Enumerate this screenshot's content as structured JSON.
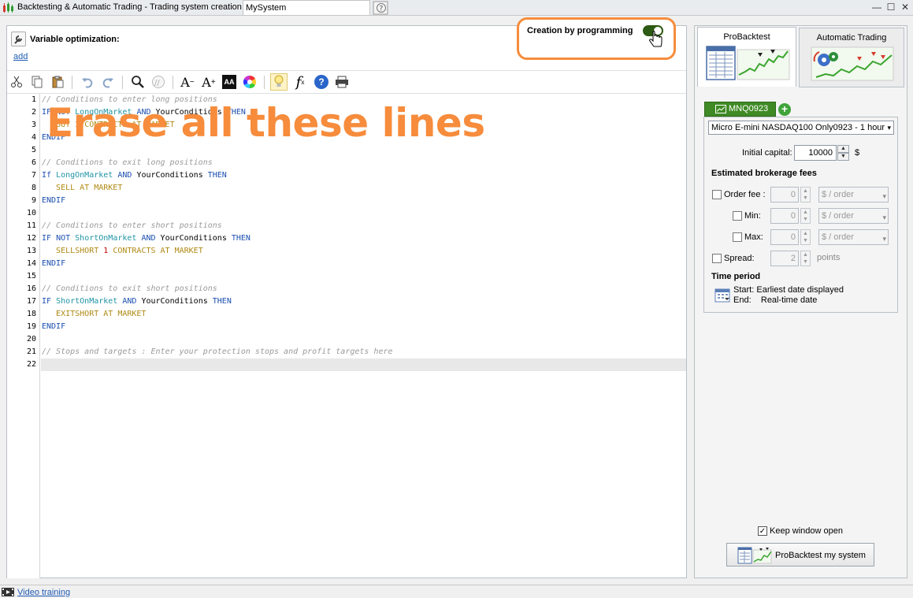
{
  "window": {
    "title": "Backtesting & Automatic Trading - Trading system creation",
    "system_name": "MySystem",
    "controls": {
      "minimize": "—",
      "maximize": "☐",
      "close": "✕"
    }
  },
  "header": {
    "variable_optimization": "Variable optimization:",
    "add_link": "add",
    "creation_by_programming": "Creation by programming",
    "toggle_state": "on"
  },
  "toolbar": {
    "icons": [
      "cut-icon",
      "copy-icon",
      "paste-icon",
      "undo-icon",
      "redo-icon",
      "search-icon",
      "comment-icon",
      "decrease-font-icon",
      "increase-font-icon",
      "text-style-icon",
      "color-wheel-icon",
      "lightbulb-icon",
      "function-icon",
      "help-icon",
      "print-icon"
    ],
    "decrease_font": "A",
    "increase_font": "A",
    "text_style": "AA",
    "function": "f",
    "help": "?"
  },
  "editor": {
    "lines": [
      {
        "n": "1",
        "tokens": [
          {
            "t": "// Conditions to enter long positions",
            "c": "cmt"
          }
        ]
      },
      {
        "n": "2",
        "tokens": [
          {
            "t": "IF ",
            "c": "kw"
          },
          {
            "t": "NOT ",
            "c": "kw"
          },
          {
            "t": "LongOnMarket ",
            "c": "id"
          },
          {
            "t": "AND ",
            "c": "kw"
          },
          {
            "t": "YourConditions ",
            "c": "txt"
          },
          {
            "t": "THEN",
            "c": "kw"
          }
        ]
      },
      {
        "n": "3",
        "tokens": [
          {
            "t": "   BUY ",
            "c": "act"
          },
          {
            "t": "1 ",
            "c": "num"
          },
          {
            "t": "CONTRACTS AT MARKET",
            "c": "act"
          }
        ]
      },
      {
        "n": "4",
        "tokens": [
          {
            "t": "ENDIF",
            "c": "kw"
          }
        ]
      },
      {
        "n": "5",
        "tokens": []
      },
      {
        "n": "6",
        "tokens": [
          {
            "t": "// Conditions to exit long positions",
            "c": "cmt"
          }
        ]
      },
      {
        "n": "7",
        "tokens": [
          {
            "t": "If ",
            "c": "kw"
          },
          {
            "t": "LongOnMarket ",
            "c": "id"
          },
          {
            "t": "AND ",
            "c": "kw"
          },
          {
            "t": "YourConditions ",
            "c": "txt"
          },
          {
            "t": "THEN",
            "c": "kw"
          }
        ]
      },
      {
        "n": "8",
        "tokens": [
          {
            "t": "   SELL AT MARKET",
            "c": "act"
          }
        ]
      },
      {
        "n": "9",
        "tokens": [
          {
            "t": "ENDIF",
            "c": "kw"
          }
        ]
      },
      {
        "n": "10",
        "tokens": []
      },
      {
        "n": "11",
        "tokens": [
          {
            "t": "// Conditions to enter short positions",
            "c": "cmt"
          }
        ]
      },
      {
        "n": "12",
        "tokens": [
          {
            "t": "IF ",
            "c": "kw"
          },
          {
            "t": "NOT ",
            "c": "kw"
          },
          {
            "t": "ShortOnMarket ",
            "c": "id"
          },
          {
            "t": "AND ",
            "c": "kw"
          },
          {
            "t": "YourConditions ",
            "c": "txt"
          },
          {
            "t": "THEN",
            "c": "kw"
          }
        ]
      },
      {
        "n": "13",
        "tokens": [
          {
            "t": "   SELLSHORT ",
            "c": "act"
          },
          {
            "t": "1 ",
            "c": "num"
          },
          {
            "t": "CONTRACTS AT MARKET",
            "c": "act"
          }
        ]
      },
      {
        "n": "14",
        "tokens": [
          {
            "t": "ENDIF",
            "c": "kw"
          }
        ]
      },
      {
        "n": "15",
        "tokens": []
      },
      {
        "n": "16",
        "tokens": [
          {
            "t": "// Conditions to exit short positions",
            "c": "cmt"
          }
        ]
      },
      {
        "n": "17",
        "tokens": [
          {
            "t": "IF ",
            "c": "kw"
          },
          {
            "t": "ShortOnMarket ",
            "c": "id"
          },
          {
            "t": "AND ",
            "c": "kw"
          },
          {
            "t": "YourConditions ",
            "c": "txt"
          },
          {
            "t": "THEN",
            "c": "kw"
          }
        ]
      },
      {
        "n": "18",
        "tokens": [
          {
            "t": "   EXITSHORT AT MARKET",
            "c": "act"
          }
        ]
      },
      {
        "n": "19",
        "tokens": [
          {
            "t": "ENDIF",
            "c": "kw"
          }
        ]
      },
      {
        "n": "20",
        "tokens": []
      },
      {
        "n": "21",
        "tokens": [
          {
            "t": "// Stops and targets : Enter your protection stops and profit targets here",
            "c": "cmt"
          }
        ]
      },
      {
        "n": "22",
        "tokens": []
      }
    ],
    "current_line": "22",
    "overlay_text": "Erase all these lines"
  },
  "right_panel": {
    "tab_probacktest": "ProBacktest",
    "tab_automatic_trading": "Automatic Trading",
    "instrument_tab": "MNQ0923",
    "instrument_select": "Micro E-mini NASDAQ100 Only0923 - 1 hour",
    "add_instrument": "+",
    "initial_capital_label": "Initial capital:",
    "initial_capital": "10000",
    "currency": "$",
    "fees_title": "Estimated brokerage fees",
    "order_fee_label": "Order fee :",
    "order_fee_value": "0",
    "order_fee_unit": "$ / order",
    "min_label": "Min:",
    "min_value": "0",
    "min_unit": "$ / order",
    "max_label": "Max:",
    "max_value": "0",
    "max_unit": "$ / order",
    "spread_label": "Spread:",
    "spread_value": "2",
    "spread_unit": "points",
    "time_period_title": "Time period",
    "start_label": "Start:",
    "start_value": "Earliest date displayed",
    "end_label": "End:",
    "end_value": "Real-time date",
    "keep_window_open": "Keep window open",
    "keep_checked": "✓",
    "backtest_button": "ProBacktest my system"
  },
  "statusbar": {
    "video_training": "Video training"
  },
  "colors": {
    "accent": "#f68c3c",
    "toggle": "#2d5a14",
    "instrument_tab": "#3f8a25",
    "link": "#1f5cb5"
  }
}
